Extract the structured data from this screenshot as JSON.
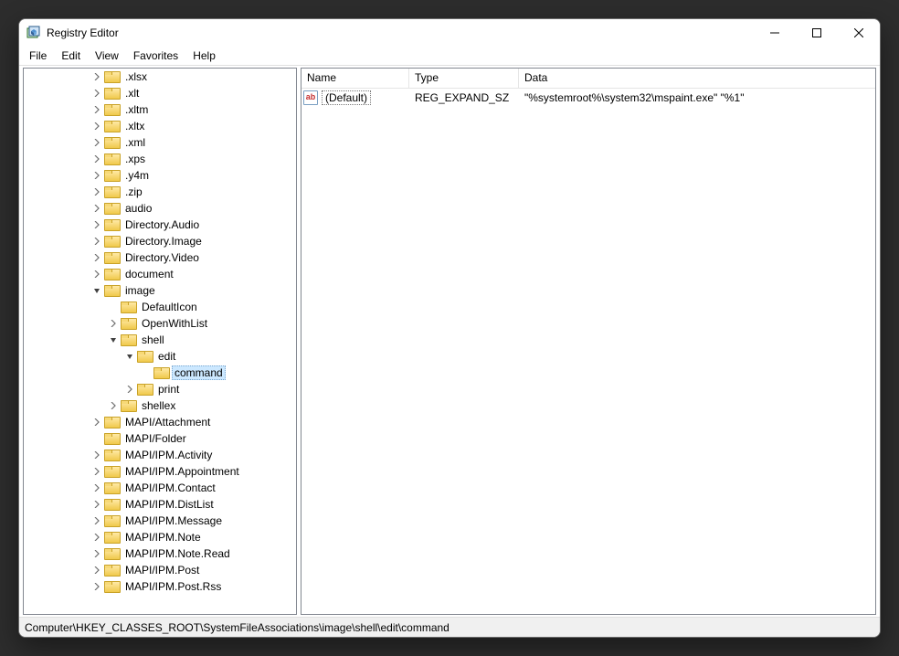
{
  "window": {
    "title": "Registry Editor"
  },
  "menubar": [
    "File",
    "Edit",
    "View",
    "Favorites",
    "Help"
  ],
  "tree": [
    {
      "indent": 4,
      "exp": "collapsed",
      "label": ".xlsx"
    },
    {
      "indent": 4,
      "exp": "collapsed",
      "label": ".xlt"
    },
    {
      "indent": 4,
      "exp": "collapsed",
      "label": ".xltm"
    },
    {
      "indent": 4,
      "exp": "collapsed",
      "label": ".xltx"
    },
    {
      "indent": 4,
      "exp": "collapsed",
      "label": ".xml"
    },
    {
      "indent": 4,
      "exp": "collapsed",
      "label": ".xps"
    },
    {
      "indent": 4,
      "exp": "collapsed",
      "label": ".y4m"
    },
    {
      "indent": 4,
      "exp": "collapsed",
      "label": ".zip"
    },
    {
      "indent": 4,
      "exp": "collapsed",
      "label": "audio"
    },
    {
      "indent": 4,
      "exp": "collapsed",
      "label": "Directory.Audio"
    },
    {
      "indent": 4,
      "exp": "collapsed",
      "label": "Directory.Image"
    },
    {
      "indent": 4,
      "exp": "collapsed",
      "label": "Directory.Video"
    },
    {
      "indent": 4,
      "exp": "collapsed",
      "label": "document"
    },
    {
      "indent": 4,
      "exp": "expanded",
      "label": "image"
    },
    {
      "indent": 5,
      "exp": "none",
      "label": "DefaultIcon"
    },
    {
      "indent": 5,
      "exp": "collapsed",
      "label": "OpenWithList"
    },
    {
      "indent": 5,
      "exp": "expanded",
      "label": "shell"
    },
    {
      "indent": 6,
      "exp": "expanded",
      "label": "edit"
    },
    {
      "indent": 7,
      "exp": "none",
      "label": "command",
      "selected": true
    },
    {
      "indent": 6,
      "exp": "collapsed",
      "label": "print"
    },
    {
      "indent": 5,
      "exp": "collapsed",
      "label": "shellex"
    },
    {
      "indent": 4,
      "exp": "collapsed",
      "label": "MAPI/Attachment"
    },
    {
      "indent": 4,
      "exp": "none",
      "label": "MAPI/Folder"
    },
    {
      "indent": 4,
      "exp": "collapsed",
      "label": "MAPI/IPM.Activity"
    },
    {
      "indent": 4,
      "exp": "collapsed",
      "label": "MAPI/IPM.Appointment"
    },
    {
      "indent": 4,
      "exp": "collapsed",
      "label": "MAPI/IPM.Contact"
    },
    {
      "indent": 4,
      "exp": "collapsed",
      "label": "MAPI/IPM.DistList"
    },
    {
      "indent": 4,
      "exp": "collapsed",
      "label": "MAPI/IPM.Message"
    },
    {
      "indent": 4,
      "exp": "collapsed",
      "label": "MAPI/IPM.Note"
    },
    {
      "indent": 4,
      "exp": "collapsed",
      "label": "MAPI/IPM.Note.Read"
    },
    {
      "indent": 4,
      "exp": "collapsed",
      "label": "MAPI/IPM.Post"
    },
    {
      "indent": 4,
      "exp": "collapsed",
      "label": "MAPI/IPM.Post.Rss"
    }
  ],
  "list": {
    "columns": {
      "name": "Name",
      "type": "Type",
      "data": "Data"
    },
    "rows": [
      {
        "name": "(Default)",
        "type": "REG_EXPAND_SZ",
        "data": "\"%systemroot%\\system32\\mspaint.exe\" \"%1\""
      }
    ]
  },
  "statusbar": "Computer\\HKEY_CLASSES_ROOT\\SystemFileAssociations\\image\\shell\\edit\\command"
}
